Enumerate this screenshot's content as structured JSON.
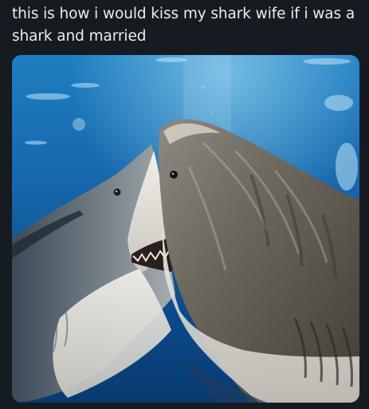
{
  "post": {
    "caption": "this is how i would kiss my shark wife if i was a shark and married"
  },
  "image": {
    "subject": "two-sharks-underwater",
    "colors": {
      "background": "#161b22",
      "water_top": "#1e78b8",
      "water_deep": "#0a3f7a",
      "shark_dark": "#5e5a52",
      "shark_belly": "#e4e2da"
    }
  }
}
